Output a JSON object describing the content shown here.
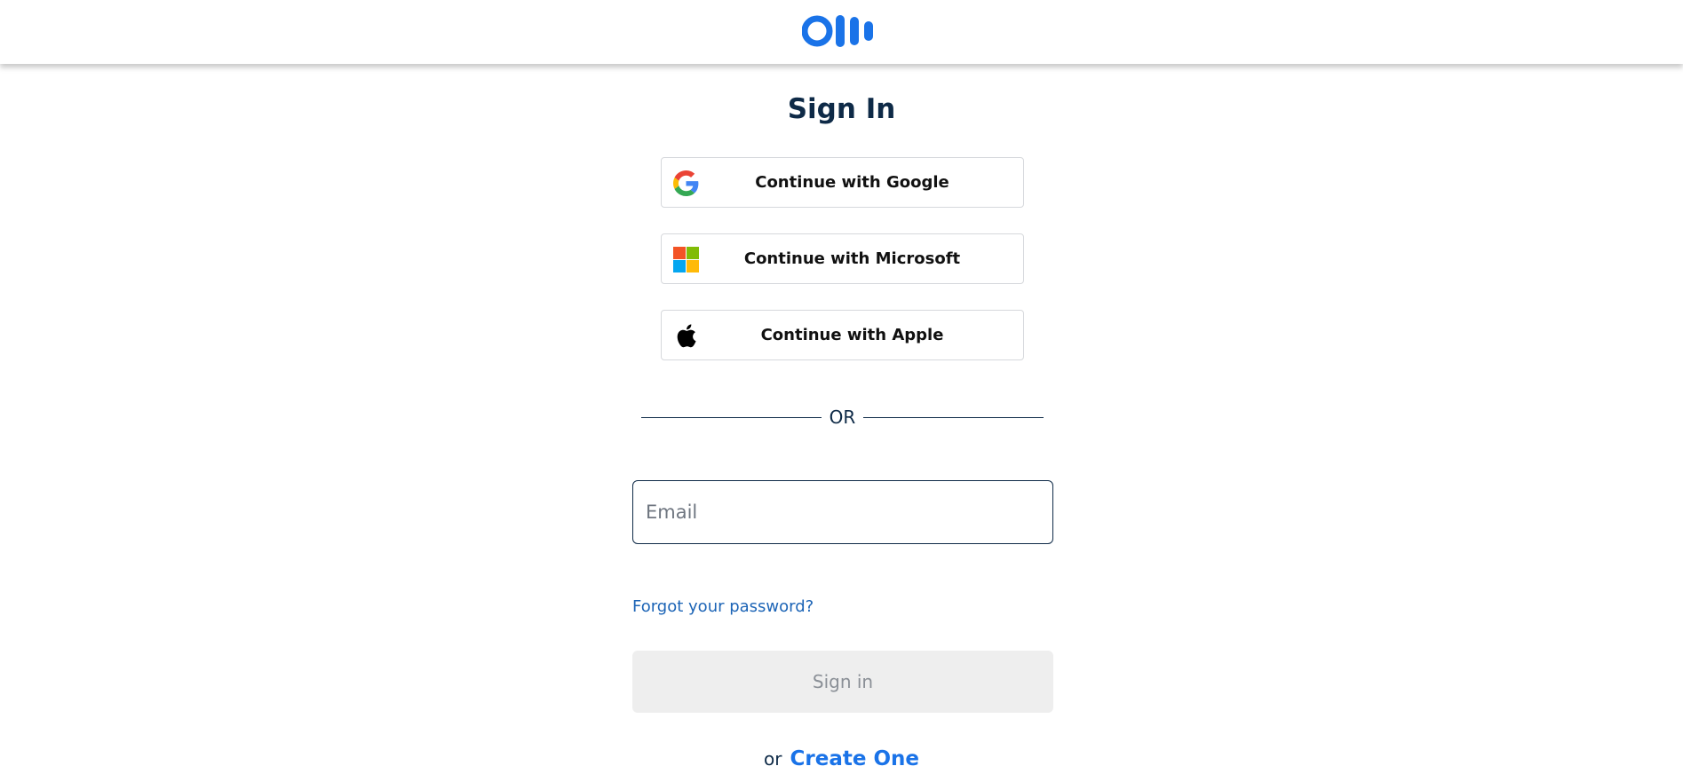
{
  "brand": {
    "name": "Otter",
    "logo_icon": "otter-logo-icon",
    "accent_color": "#1a73e8"
  },
  "page": {
    "title": "Sign In"
  },
  "social_buttons": [
    {
      "label": "Continue with Google",
      "icon": "google-icon"
    },
    {
      "label": "Continue with Microsoft",
      "icon": "microsoft-icon"
    },
    {
      "label": "Continue with Apple",
      "icon": "apple-icon"
    }
  ],
  "divider": {
    "text": "OR"
  },
  "email": {
    "placeholder": "Email",
    "value": ""
  },
  "forgot_password": {
    "label": "Forgot your password?"
  },
  "signin": {
    "label": "Sign in",
    "disabled": true
  },
  "create_account": {
    "prefix": "or",
    "link_label": "Create One"
  }
}
